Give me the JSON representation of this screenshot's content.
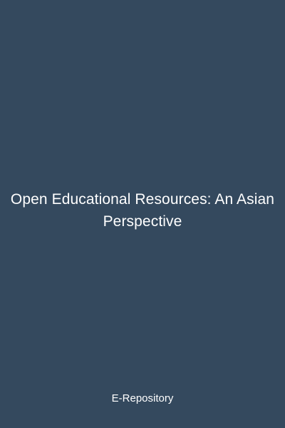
{
  "cover": {
    "title": "Open Educational Resources: An Asian Perspective",
    "footer": "E-Repository",
    "background_color": "#34495e",
    "text_color": "#ffffff"
  }
}
